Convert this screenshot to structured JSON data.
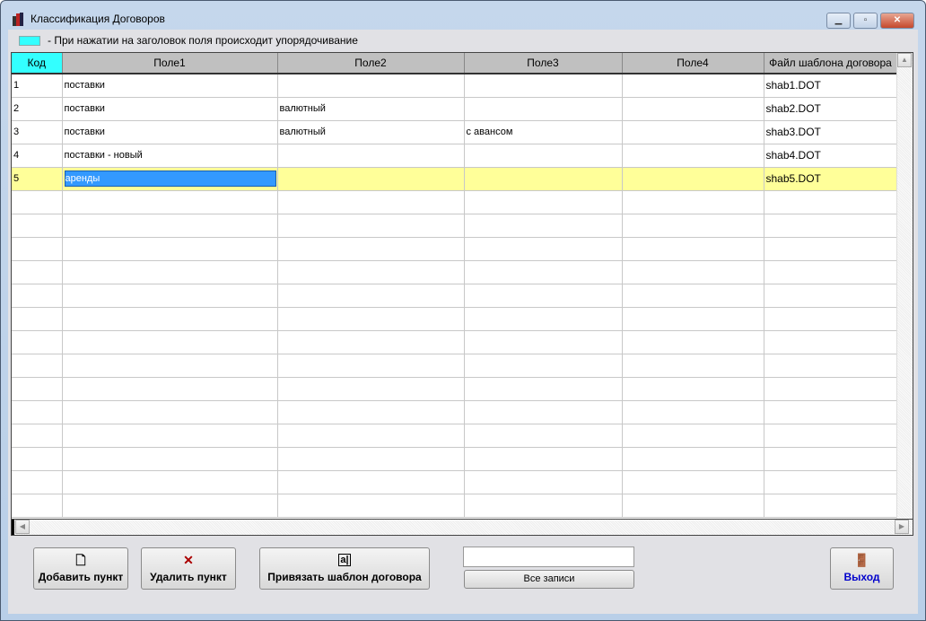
{
  "window": {
    "title": "Классификация Договоров"
  },
  "legend": {
    "text": "- При нажатии на заголовок поля  происходит упорядочивание",
    "color": "#33ffff"
  },
  "grid": {
    "columns": [
      "Код",
      "Поле1",
      "Поле2",
      "Поле3",
      "Поле4",
      "Файл шаблона договора"
    ],
    "rows": [
      [
        "1",
        "поставки",
        "",
        "",
        "",
        "shab1.DOT"
      ],
      [
        "2",
        "поставки",
        "валютный",
        "",
        "",
        "shab2.DOT"
      ],
      [
        "3",
        "поставки",
        "валютный",
        "с авансом",
        "",
        "shab3.DOT"
      ],
      [
        "4",
        "поставки - новый",
        "",
        "",
        "",
        "shab4.DOT"
      ],
      [
        "5",
        "аренды",
        "",
        "",
        "",
        "shab5.DOT"
      ]
    ],
    "selected_row": 4,
    "empty_rows": 14,
    "selection_color": "#ffff99"
  },
  "buttons": {
    "add": "Добавить пункт",
    "delete": "Удалить пункт",
    "bind": "Привязать шаблон договора",
    "all": "Все записи",
    "exit": "Выход"
  },
  "filter": {
    "value": ""
  }
}
